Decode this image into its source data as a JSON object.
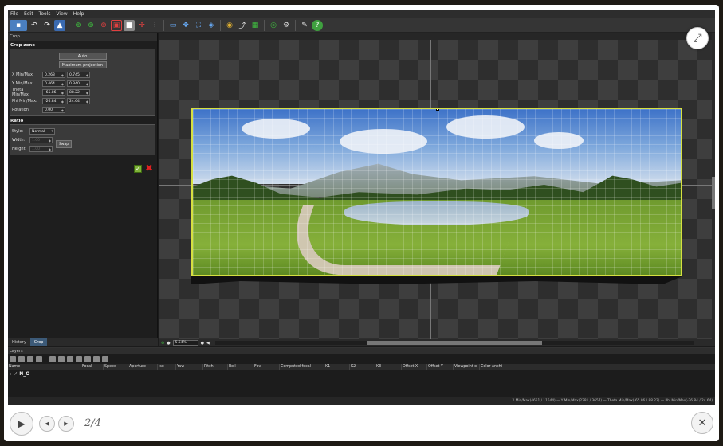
{
  "menubar": {
    "items": [
      "File",
      "Edit",
      "Tools",
      "View",
      "Help"
    ]
  },
  "crop_panel": {
    "title": "Crop",
    "crop_zone": {
      "title": "Crop zone",
      "auto_label": "Auto",
      "max_projection_label": "Maximum projection",
      "x_label": "X Min/Max:",
      "x_min": "0.263",
      "x_max": "0.745",
      "y_label": "Y Min/Max:",
      "y_min": "0.464",
      "y_max": "0.340",
      "theta_label": "Theta Min/Max:",
      "theta_min": "-65.86",
      "theta_max": "88.22",
      "phi_label": "Phi Min/Max:",
      "phi_min": "-26.84",
      "phi_max": "24.64",
      "rotation_label": "Rotation:",
      "rotation": "0.00"
    },
    "ratio": {
      "title": "Ratio",
      "style_label": "Style:",
      "style_value": "Normal",
      "width_label": "Width:",
      "width_value": "1.00",
      "height_label": "Height:",
      "height_value": "1.00",
      "swap_label": "Swap"
    }
  },
  "tabs": {
    "history": "History",
    "crop": "Crop"
  },
  "canvas": {
    "zoom": "5.54%"
  },
  "layers": {
    "title": "Layers",
    "columns": [
      "Name",
      "Focal",
      "Speed",
      "Aperture",
      "Iso",
      "Yaw",
      "Pitch",
      "Roll",
      "Fov",
      "Computed focal",
      "K1",
      "K2",
      "K3",
      "Offset X",
      "Offset Y",
      "Viewpoint o",
      "Color anchi"
    ],
    "row_label": "N_O"
  },
  "statusbar": {
    "text": "X Min/Max(4651 / 11544) — Y Min/Max(2281 / 3657) — Theta Min/Max(-65.86 / 88.22) — Phi Min/Max(-26.84 / 24.64)"
  },
  "viewer": {
    "counter": "2/4"
  },
  "icons": {
    "fullscreen": "fullscreen-icon",
    "play": "play-icon",
    "prev": "prev-icon",
    "next": "next-icon",
    "close": "close-icon",
    "apply": "checkmark-icon",
    "cancel": "cancel-x-icon"
  },
  "colors": {
    "crop_border": "#d6e040",
    "active_tab": "#3c5a78",
    "cancel": "#e02020",
    "apply": "#7fb23a"
  }
}
